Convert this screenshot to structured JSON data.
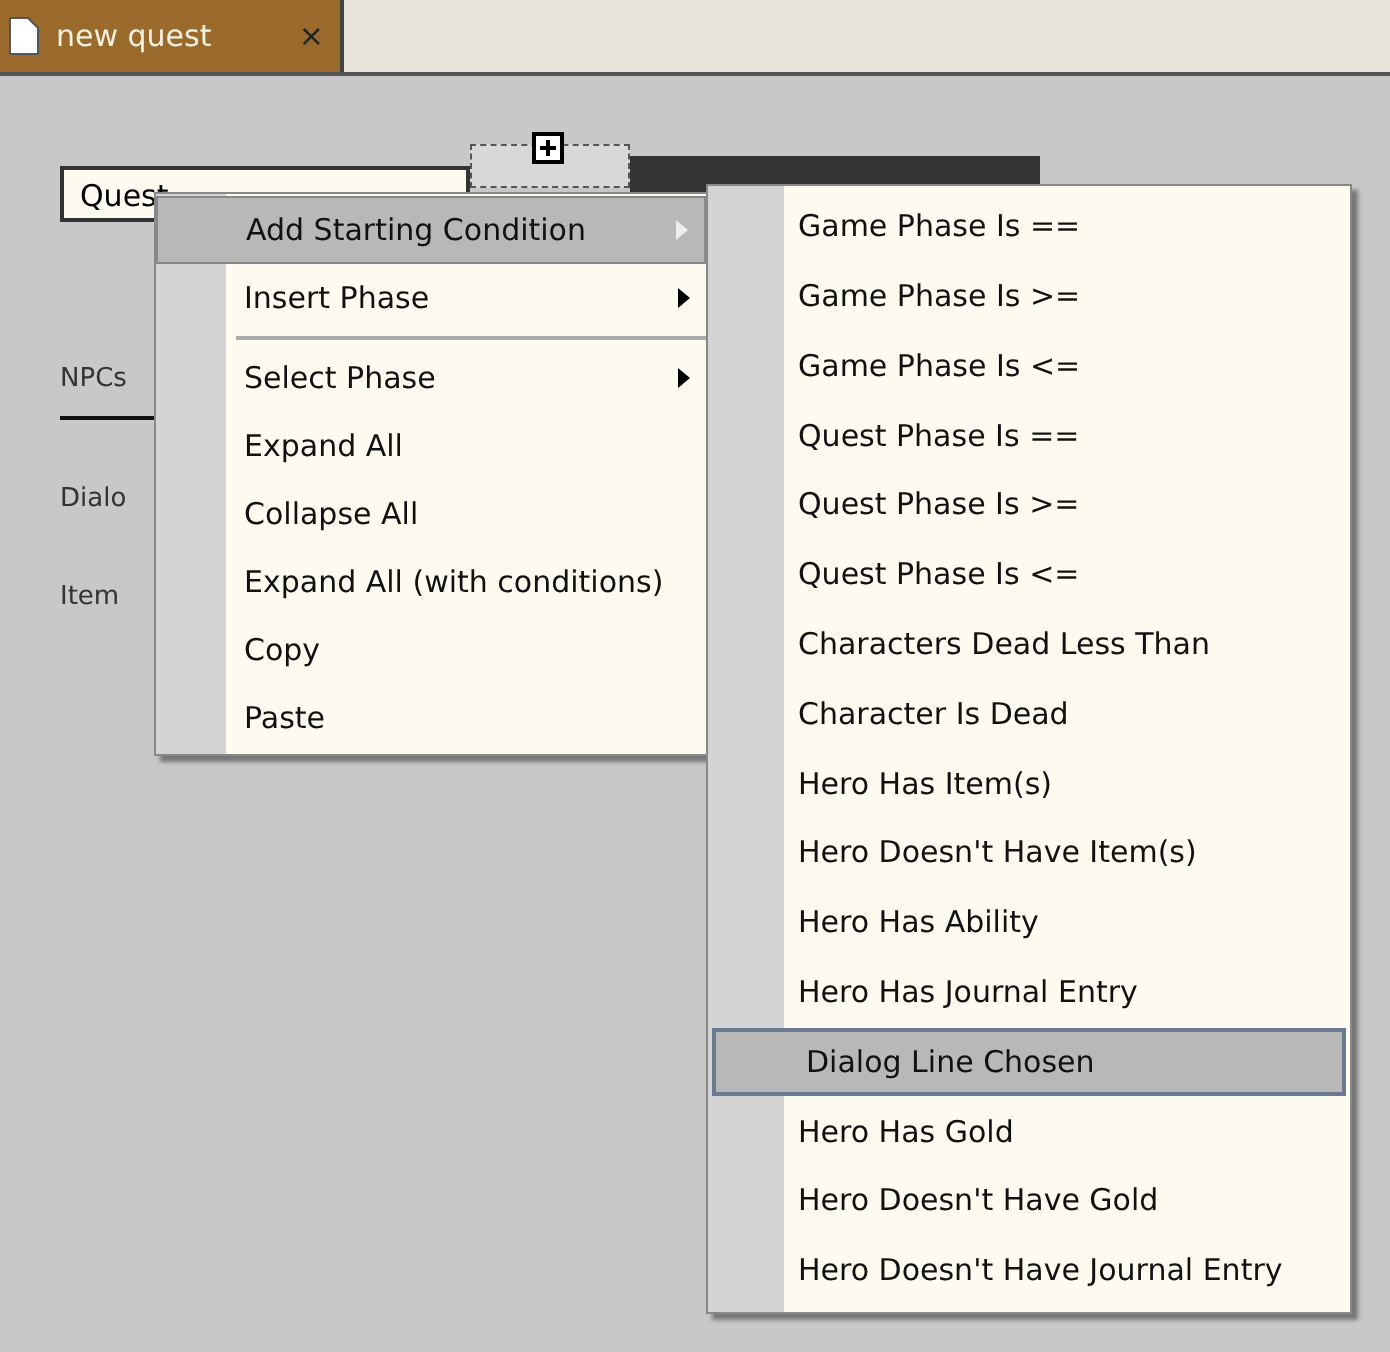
{
  "tab": {
    "title": "new quest",
    "close": "×"
  },
  "phase_field": {
    "value": "Quest"
  },
  "side_labels": [
    "NPCs",
    "Dialo",
    "Item"
  ],
  "context_menu": {
    "items": [
      {
        "label": "Add Starting Condition",
        "submenu": true,
        "selected": true,
        "separator_after": false
      },
      {
        "label": "Insert Phase",
        "submenu": true,
        "selected": false,
        "separator_after": true
      },
      {
        "label": "Select Phase",
        "submenu": true,
        "selected": false,
        "separator_after": false
      },
      {
        "label": "Expand All",
        "submenu": false,
        "selected": false,
        "separator_after": false
      },
      {
        "label": "Collapse All",
        "submenu": false,
        "selected": false,
        "separator_after": false
      },
      {
        "label": "Expand All (with conditions)",
        "submenu": false,
        "selected": false,
        "separator_after": false
      },
      {
        "label": "Copy",
        "submenu": false,
        "selected": false,
        "separator_after": false
      },
      {
        "label": "Paste",
        "submenu": false,
        "selected": false,
        "separator_after": false
      }
    ]
  },
  "submenu": {
    "items": [
      {
        "label": "Game Phase Is ==",
        "selected": false
      },
      {
        "label": "Game Phase Is >=",
        "selected": false
      },
      {
        "label": "Game Phase Is <=",
        "selected": false
      },
      {
        "label": "Quest Phase Is ==",
        "selected": false
      },
      {
        "label": "Quest Phase Is >=",
        "selected": false
      },
      {
        "label": "Quest Phase Is <=",
        "selected": false
      },
      {
        "label": "Characters Dead Less Than",
        "selected": false
      },
      {
        "label": "Character Is Dead",
        "selected": false
      },
      {
        "label": "Hero Has Item(s)",
        "selected": false
      },
      {
        "label": "Hero Doesn't Have Item(s)",
        "selected": false
      },
      {
        "label": "Hero Has Ability",
        "selected": false
      },
      {
        "label": "Hero Has Journal Entry",
        "selected": false
      },
      {
        "label": "Dialog Line Chosen",
        "selected": true
      },
      {
        "label": "Hero Has Gold",
        "selected": false
      },
      {
        "label": "Hero Doesn't Have Gold",
        "selected": false
      },
      {
        "label": "Hero Doesn't Have Journal Entry",
        "selected": false
      }
    ]
  }
}
